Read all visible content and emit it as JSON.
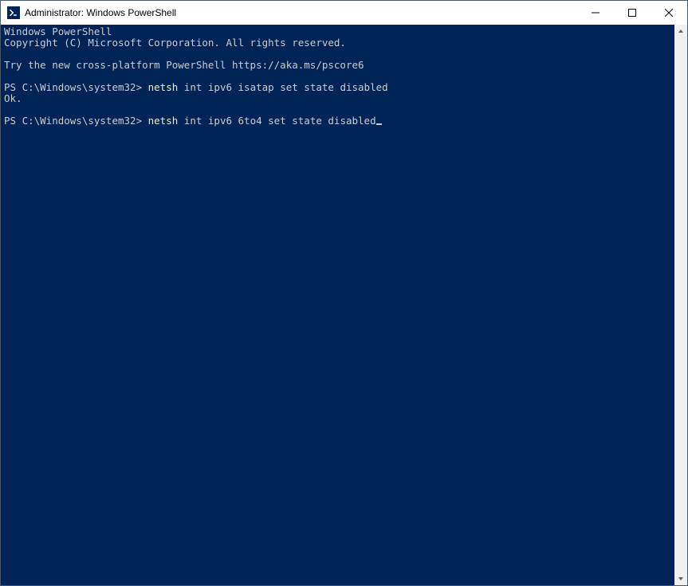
{
  "window": {
    "title": "Administrator: Windows PowerShell"
  },
  "terminal": {
    "banner1": "Windows PowerShell",
    "banner2": "Copyright (C) Microsoft Corporation. All rights reserved.",
    "banner3": "Try the new cross-platform PowerShell https://aka.ms/pscore6",
    "prompt": "PS C:\\Windows\\system32> ",
    "cmd_keyword": "netsh",
    "cmd1_rest": " int ipv6 isatap set state disabled",
    "cmd1_output": "Ok.",
    "cmd2_rest": " int ipv6 6to4 set state disabled"
  },
  "colors": {
    "terminal_bg": "#012456",
    "terminal_fg": "#cccccc",
    "cmd_highlight": "#f9f1a5"
  }
}
